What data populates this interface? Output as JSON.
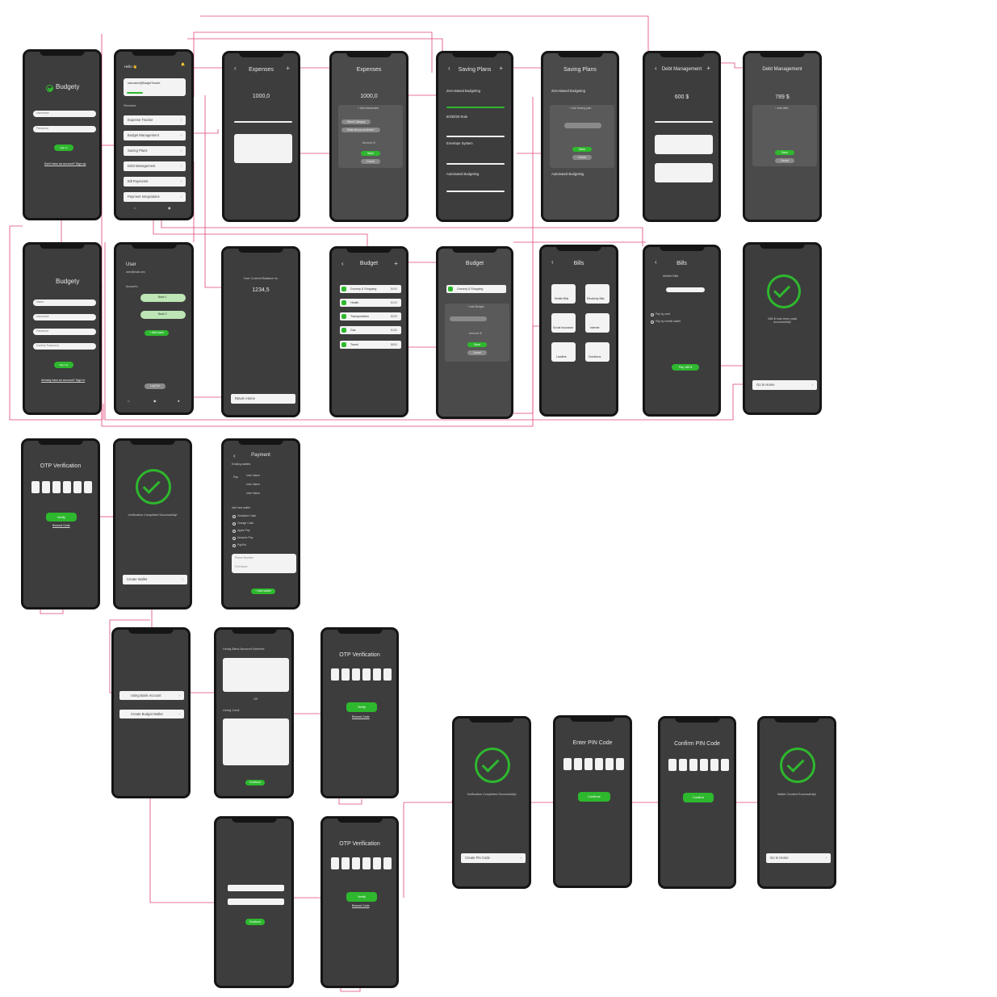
{
  "brand": "Budgety",
  "accent_color": "#2eb82e",
  "connector_color": "#e0457b",
  "login": {
    "user_ph": "Username",
    "pass_ph": "Password",
    "btn": "Sign In",
    "link": "Don't have an account? Sign up"
  },
  "signup": {
    "name_ph": "Name",
    "user_ph": "Username",
    "pass_ph": "Password",
    "confirm_ph": "Confirm Password",
    "btn": "Sign Up",
    "link": "Already have an account? Sign in"
  },
  "home": {
    "greeting": "Hello 👋",
    "email": "username@BudgetTracker",
    "services_label": "Services",
    "services": [
      "Expense Tracker",
      "Budget Management",
      "Saving Plans",
      "Debt Management",
      "Bill Payments",
      "Payment Integrations"
    ],
    "nav": [
      "Home",
      "Profile"
    ]
  },
  "user": {
    "name": "User",
    "email": "user@mail.com",
    "accounts_label": "Account's",
    "banks": [
      "Bank 1",
      "Bank 2"
    ],
    "add_bank": "+ Add bank",
    "logout": "Log Out",
    "nav": [
      "Home",
      "Profile",
      "Profile"
    ]
  },
  "balance": {
    "label": "Your Current Balance is:",
    "value": "1234,5",
    "return": "Return Home"
  },
  "expenses": {
    "title": "Expenses",
    "amount": "1000,0",
    "add": "+ Add transaction",
    "save": "Save",
    "cancel": "Cancel",
    "cat_ph": "Select Category",
    "desc_ph": "What did you purchase?",
    "amount_label": "Amount: $"
  },
  "saving": {
    "title": "Saving Plans",
    "plans": [
      "Zero-Based Budgeting",
      "50/30/20 Rule",
      "Envelope System",
      "Automated Budgeting"
    ],
    "add": "+ Add Saving plan",
    "save": "Save",
    "cancel": "Cancel"
  },
  "debt": {
    "title": "Debt Management",
    "amount1": "600 $",
    "amount2": "789 $",
    "add": "+ Add debt",
    "save": "Save",
    "cancel": "Cancel"
  },
  "budget": {
    "title": "Budget",
    "rows": [
      "Grocery & Shopping",
      "Health",
      "Transportation",
      "Gas",
      "Travel"
    ],
    "values": [
      "$400",
      "$100",
      "$200",
      "$150",
      "$800"
    ],
    "add": "+ Add Budget",
    "save": "Save",
    "cancel": "Cancel",
    "amount_label": "Amount: $"
  },
  "bills": {
    "title": "Bills",
    "items": [
      "Mobile Bills",
      "Electricity Bills",
      "Social Insurance",
      "Internet",
      "Landline",
      "Donations"
    ],
    "mobile_label": "Mobile Bills",
    "pay_card": "Pay by card",
    "pay_wallet": "Pay by mobile wallet",
    "pay_btn": "Pay 185 $"
  },
  "paid": {
    "msg": "185 $ has been paid successfully",
    "home": "Go to Home"
  },
  "otp": {
    "title": "OTP Verification",
    "verify": "Verify",
    "resend": "Resend Code"
  },
  "verified": {
    "msg": "Verification Completed Successfully!",
    "create_wallet": "Create Wallet",
    "create_pin": "Create Pin Code"
  },
  "payment": {
    "title": "Payment",
    "existing": "Existing wallets",
    "wallets": [
      "Pay",
      "Username",
      "Username"
    ],
    "wallet_users": [
      "User Name",
      "User Name",
      "User Name"
    ],
    "add_new": "Add new wallet",
    "options": [
      "Vodafone Cash",
      "Orange Cash",
      "Apple Pay",
      "Amazon Pay",
      "PayPal"
    ],
    "num_ph": "Phone Number",
    "name_ph": "Full Name",
    "add_btn": "+ Add wallet"
  },
  "wallet_choice": {
    "bank": "Using Bank Account",
    "create": "Create Budget Wallet"
  },
  "bank_form": {
    "bank_title": "Using Bank Account Number:",
    "card_title": "Using Card:",
    "or": "OR",
    "submit": "Continue"
  },
  "pin": {
    "enter": "Enter PIN Code",
    "confirm": "Confirm PIN Code",
    "continue": "Continue",
    "confirm_btn": "Confirm"
  },
  "wallet_done": {
    "msg": "Wallet Created Successfully!",
    "home": "Go to Home"
  }
}
